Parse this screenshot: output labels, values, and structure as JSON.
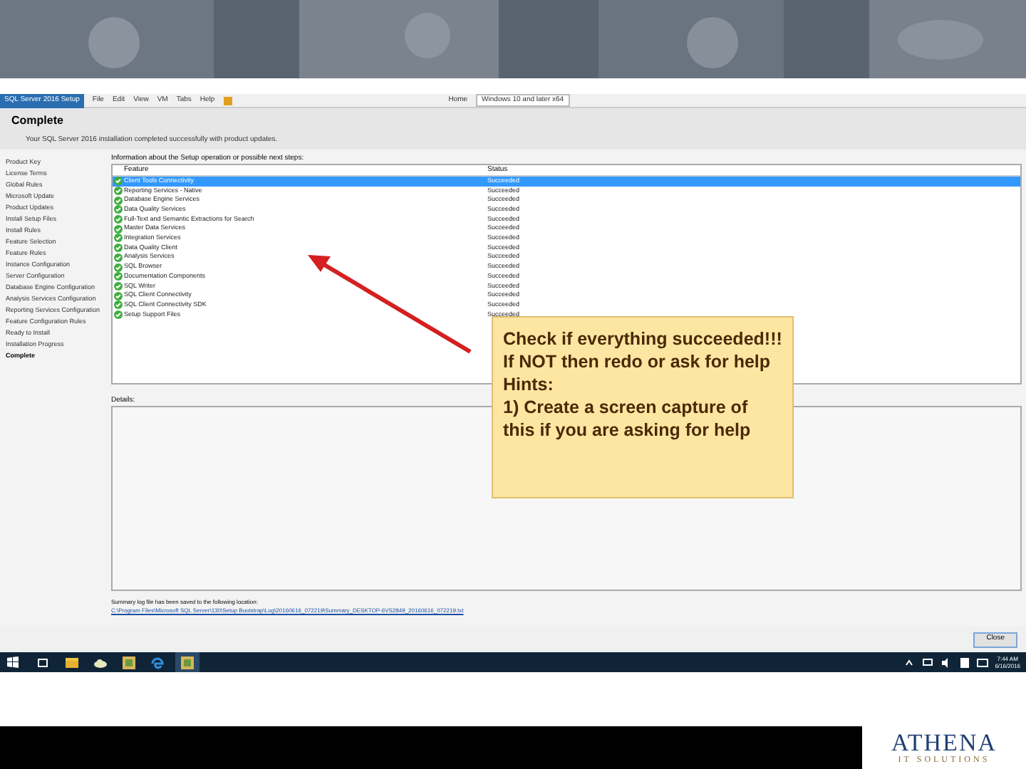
{
  "vm_toolbar": {
    "tabs": [
      {
        "label": "SQL Server 2016 Setup",
        "selected": true
      }
    ],
    "menus": [
      "File",
      "Edit",
      "View",
      "VM",
      "Tabs",
      "Help"
    ],
    "home_tab": "Home",
    "vm_tab": "Windows 10 and later x64"
  },
  "setup": {
    "page_title": "Complete",
    "subtitle": "Your SQL Server 2016 installation completed successfully with product updates.",
    "steps": [
      {
        "label": "Product Key",
        "selected": false
      },
      {
        "label": "License Terms",
        "selected": false
      },
      {
        "label": "Global Rules",
        "selected": false
      },
      {
        "label": "Microsoft Update",
        "selected": false
      },
      {
        "label": "Product Updates",
        "selected": false
      },
      {
        "label": "Install Setup Files",
        "selected": false
      },
      {
        "label": "Install Rules",
        "selected": false
      },
      {
        "label": "Feature Selection",
        "selected": false
      },
      {
        "label": "Feature Rules",
        "selected": false
      },
      {
        "label": "Instance Configuration",
        "selected": false
      },
      {
        "label": "Server Configuration",
        "selected": false
      },
      {
        "label": "Database Engine Configuration",
        "selected": false
      },
      {
        "label": "Analysis Services Configuration",
        "selected": false
      },
      {
        "label": "Reporting Services Configuration",
        "selected": false
      },
      {
        "label": "Feature Configuration Rules",
        "selected": false
      },
      {
        "label": "Ready to Install",
        "selected": false
      },
      {
        "label": "Installation Progress",
        "selected": false
      },
      {
        "label": "Complete",
        "selected": true
      }
    ],
    "info_label": "Information about the Setup operation or possible next steps:",
    "columns": [
      "Feature",
      "Status"
    ],
    "rows": [
      {
        "feature": "Client Tools Connectivity",
        "status": "Succeeded",
        "selected": true
      },
      {
        "feature": "Reporting Services - Native",
        "status": "Succeeded",
        "selected": false
      },
      {
        "feature": "Database Engine Services",
        "status": "Succeeded",
        "selected": false
      },
      {
        "feature": "Data Quality Services",
        "status": "Succeeded",
        "selected": false
      },
      {
        "feature": "Full-Text and Semantic Extractions for Search",
        "status": "Succeeded",
        "selected": false
      },
      {
        "feature": "Master Data Services",
        "status": "Succeeded",
        "selected": false
      },
      {
        "feature": "Integration Services",
        "status": "Succeeded",
        "selected": false
      },
      {
        "feature": "Data Quality Client",
        "status": "Succeeded",
        "selected": false
      },
      {
        "feature": "Analysis Services",
        "status": "Succeeded",
        "selected": false
      },
      {
        "feature": "SQL Browser",
        "status": "Succeeded",
        "selected": false
      },
      {
        "feature": "Documentation Components",
        "status": "Succeeded",
        "selected": false
      },
      {
        "feature": "SQL Writer",
        "status": "Succeeded",
        "selected": false
      },
      {
        "feature": "SQL Client Connectivity",
        "status": "Succeeded",
        "selected": false
      },
      {
        "feature": "SQL Client Connectivity SDK",
        "status": "Succeeded",
        "selected": false
      },
      {
        "feature": "Setup Support Files",
        "status": "Succeeded",
        "selected": false
      }
    ],
    "details_label": "Details:",
    "summary_label": "Summary log file has been saved to the following location:",
    "log_path": "C:\\Program Files\\Microsoft SQL Server\\130\\Setup Bootstrap\\Log\\20160616_072219\\Summary_DESKTOP-6VS2849_20160616_072219.txt",
    "close_button": "Close"
  },
  "taskbar": {
    "time": "7:44 AM",
    "date": "6/16/2016"
  },
  "callout": {
    "lines": [
      "Check if everything succeeded!!!",
      "If NOT then redo or ask for help",
      "Hints:",
      "1) Create a screen capture of this if you are asking for help"
    ]
  },
  "logo": {
    "name": "ATHENA",
    "tagline": "IT SOLUTIONS"
  }
}
